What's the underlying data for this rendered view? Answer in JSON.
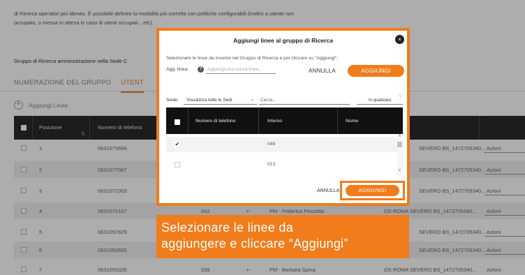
{
  "background": {
    "intro_line1": "di Ricerca operatori più idoneo. È possibile definire la modalità più corretta con politiche configurabili (inoltro a utente non",
    "intro_line2": "occupato, o messa in attesa in caso di utenti occupati…etc).",
    "group_label": "Gruppo di Ricerca amministrazione nella Sede C",
    "tabs": [
      {
        "label": "NUMERAZIONE DEL GRUPPO",
        "active": false
      },
      {
        "label": "UTENT",
        "active": true
      }
    ],
    "add_lines_label": "Aggiungi Linee",
    "table": {
      "headers": [
        "Posizione",
        "Numero di telefono"
      ],
      "sort_icon": "⇅",
      "rows": [
        {
          "pos": "1",
          "phone": "0631075694",
          "ext": "",
          "name": "",
          "sede": "SEVERO BS_1472705340...",
          "action": "Azioni"
        },
        {
          "pos": "2",
          "phone": "0631077087",
          "ext": "",
          "name": "",
          "sede": "SEVERO BS_1472705340...",
          "action": "Azioni"
        },
        {
          "pos": "3",
          "phone": "0631072303",
          "ext": "",
          "name": "",
          "sede": "SEVERO BS_1472705340...",
          "action": "Azioni"
        },
        {
          "pos": "4",
          "phone": "0631070107",
          "ext": "042",
          "name": "PM - Federica Pessotto",
          "sede": "OS ROMA SEVERO BS_1472705340...",
          "action": "Azioni"
        },
        {
          "pos": "5",
          "phone": "0631057629",
          "ext": "",
          "name": "",
          "sede": "SEVERO BS_1472705340...",
          "action": "Azioni"
        },
        {
          "pos": "6",
          "phone": "0631053605",
          "ext": "",
          "name": "",
          "sede": "SEVERO BS_1472705340...",
          "action": "Azioni"
        },
        {
          "pos": "7",
          "phone": "0631053335",
          "ext": "039",
          "name": "PM - Barbara Spina",
          "sede": "OS ROMA SEVERO BS_1472705340...",
          "action": "Azioni"
        }
      ]
    }
  },
  "modal": {
    "title": "Aggiungi linee al gruppo di Ricerca",
    "close_icon": "×",
    "instructions": "Selezionare le linee da inserire nel Gruppo di Ricerca e poi cliccare su \"Aggiungi\".",
    "add_line_label": "Agg. linea:",
    "help_icon": "?",
    "add_line_placeholder": "Aggiungi una nuova linea…",
    "cancel_top": "ANNULLA",
    "add_top": "AGGIUNGI",
    "sede_label": "Sede:",
    "sede_value": "Visualizza tutte le Sedi",
    "search_placeholder": "Cerca…",
    "filter_value": "in qualsiasi",
    "table_headers": [
      "Numero di telefono",
      "Interno",
      "Nome"
    ],
    "rows": [
      {
        "checked": true,
        "phone": "",
        "ext": "049",
        "name": ""
      },
      {
        "checked": false,
        "phone": "",
        "ext": "013",
        "name": ""
      }
    ],
    "cancel_bottom": "ANNULLA",
    "add_bottom": "AGGIUNGI"
  },
  "callout": {
    "line1": "Selezionare le linee da",
    "line2": "aggiungere e cliccare “Aggiungi”"
  },
  "colors": {
    "accent": "#f07c1b",
    "header_dark": "#2a2a2a"
  }
}
